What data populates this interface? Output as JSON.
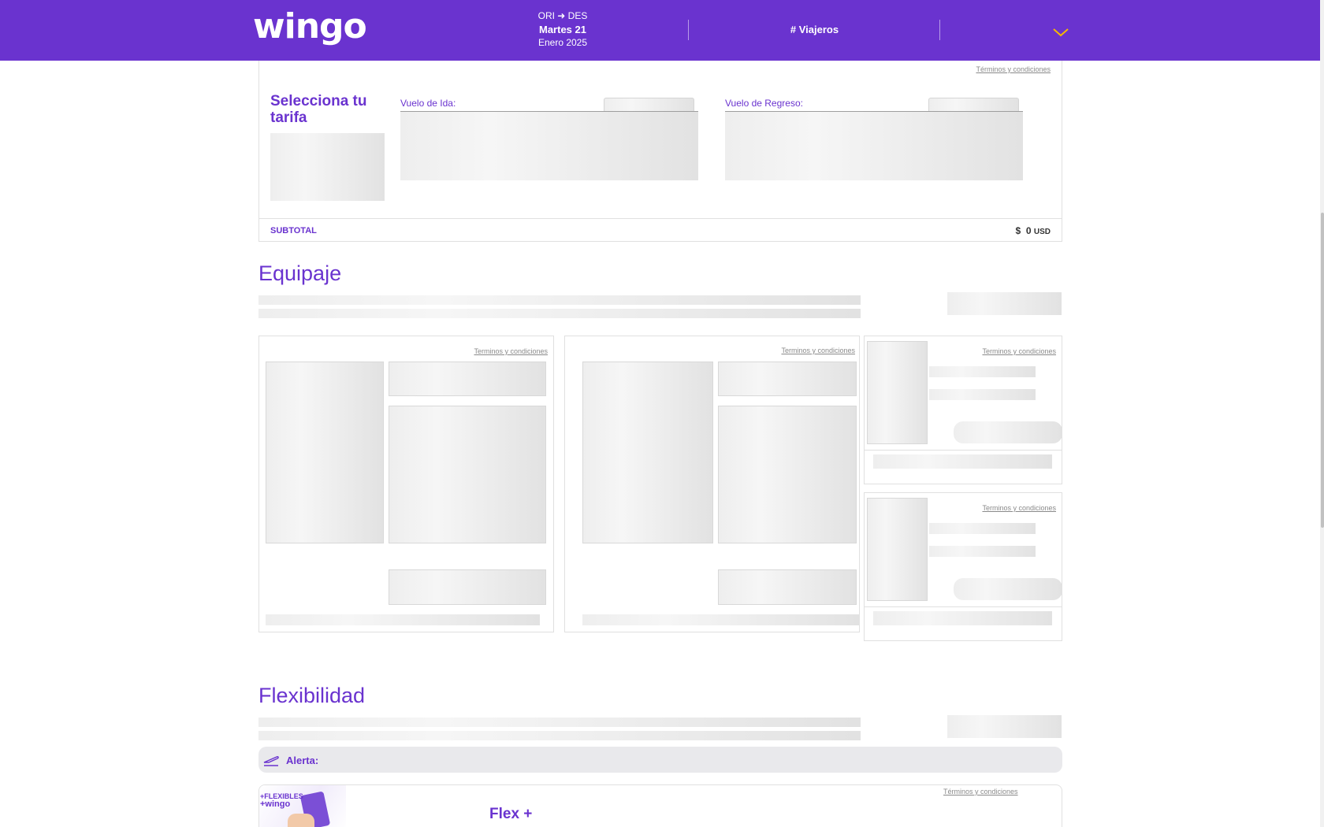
{
  "header": {
    "logo": "wingo",
    "route": "ORI ➜ DES",
    "date_day": "Martes 21",
    "date_month_year": "Enero 2025",
    "travelers": "# Viajeros",
    "dropdown_icon": "chevron-down-icon",
    "background_color": "#6a33cf",
    "chevron_color": "#f5b800"
  },
  "fare": {
    "terms": "Términos y condiciones",
    "title": "Selecciona tu tarifa",
    "outbound_label": "Vuelo de Ida:",
    "return_label": "Vuelo de Regreso:",
    "subtotal_label": "SUBTOTAL",
    "subtotal_currency_symbol": "$",
    "subtotal_amount": "0",
    "subtotal_currency": "USD"
  },
  "baggage": {
    "title": "Equipaje",
    "terms_1": "Terminos y condiciones",
    "terms_2": "Terminos y condiciones",
    "terms_3": "Terminos y condiciones",
    "terms_4": "Terminos y condiciones"
  },
  "flexibility": {
    "title": "Flexibilidad",
    "alert_label": "Alerta:",
    "alert_icon": "plane-takeoff-icon",
    "terms": "Términos y condiciones",
    "promo_line1": "+FLEXIBLES",
    "promo_line2": "+wingo",
    "flex_title": "Flex +"
  },
  "colors": {
    "accent": "#6a33cf",
    "skeleton": "#e6e6e6",
    "border": "#e0e0e0"
  }
}
